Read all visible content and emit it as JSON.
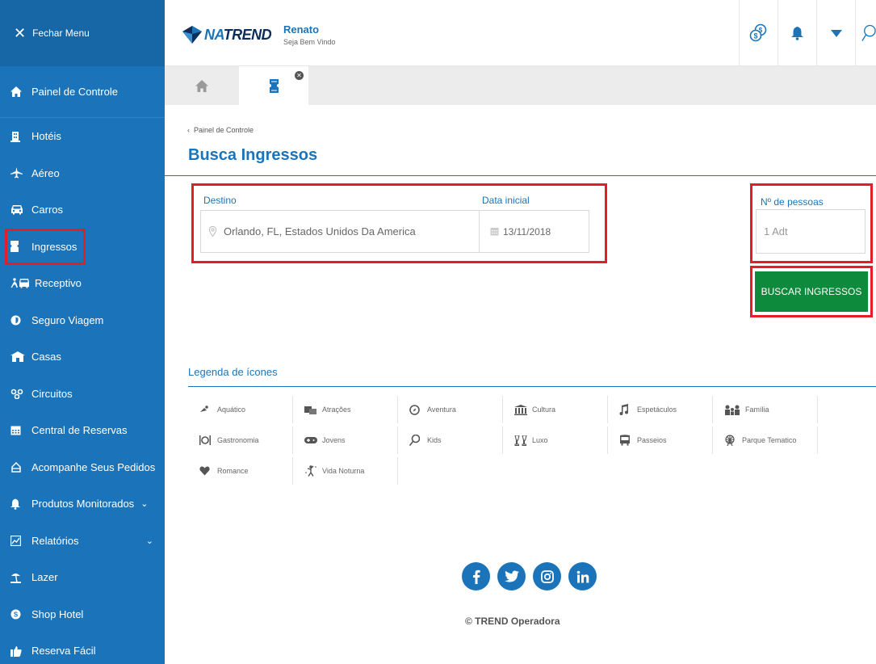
{
  "sidebar": {
    "close_label": "Fechar Menu",
    "items": [
      {
        "label": "Painel de Controle",
        "icon": "home-icon"
      },
      {
        "label": "Hotéis",
        "icon": "hotel-icon"
      },
      {
        "label": "Aéreo",
        "icon": "plane-icon"
      },
      {
        "label": "Carros",
        "icon": "car-icon"
      },
      {
        "label": "Ingressos",
        "icon": "ticket-icon",
        "active": true
      },
      {
        "label": "Receptivo",
        "icon": "receptivo-icon"
      },
      {
        "label": "Seguro Viagem",
        "icon": "shield-icon"
      },
      {
        "label": "Casas",
        "icon": "house-icon"
      },
      {
        "label": "Circuitos",
        "icon": "circuit-icon"
      },
      {
        "label": "Central de Reservas",
        "icon": "calendar-icon"
      },
      {
        "label": "Acompanhe Seus Pedidos",
        "icon": "orders-icon"
      },
      {
        "label": "Produtos Monitorados",
        "icon": "bell-icon",
        "has_dropdown": true
      },
      {
        "label": "Relatórios",
        "icon": "chart-icon",
        "has_dropdown": true
      },
      {
        "label": "Lazer",
        "icon": "beach-icon"
      },
      {
        "label": "Shop Hotel",
        "icon": "shop-icon"
      },
      {
        "label": "Reserva Fácil",
        "icon": "quick-book-icon"
      }
    ]
  },
  "header": {
    "logo_prefix": "NA",
    "logo_suffix": "TREND",
    "user_name": "Renato",
    "user_greeting": "Seja Bem Vindo"
  },
  "page": {
    "breadcrumb": "Painel de Controle",
    "title": "Busca Ingressos"
  },
  "search": {
    "destino_label": "Destino",
    "destino_value": "Orlando, FL, Estados Unidos Da America",
    "data_label": "Data inicial",
    "data_value": "13/11/2018",
    "pessoas_label": "Nº de pessoas",
    "pessoas_value": "1 Adt",
    "button_label": "BUSCAR INGRESSOS"
  },
  "legend": {
    "title": "Legenda de ícones",
    "items": [
      "Aquático",
      "Atrações",
      "Aventura",
      "Cultura",
      "Espetáculos",
      "Família",
      "Gastronomia",
      "Jovens",
      "Kids",
      "Luxo",
      "Passeios",
      "Parque Tematico",
      "Romance",
      "Vida Noturna"
    ]
  },
  "footer": {
    "copyright": "© TREND Operadora",
    "social": [
      "f",
      "t",
      "ig",
      "in"
    ]
  },
  "colors": {
    "sidebar": "#1b74b9",
    "accent": "#1b74b9",
    "button": "#0e8a3c",
    "highlight": "#e21f26"
  }
}
